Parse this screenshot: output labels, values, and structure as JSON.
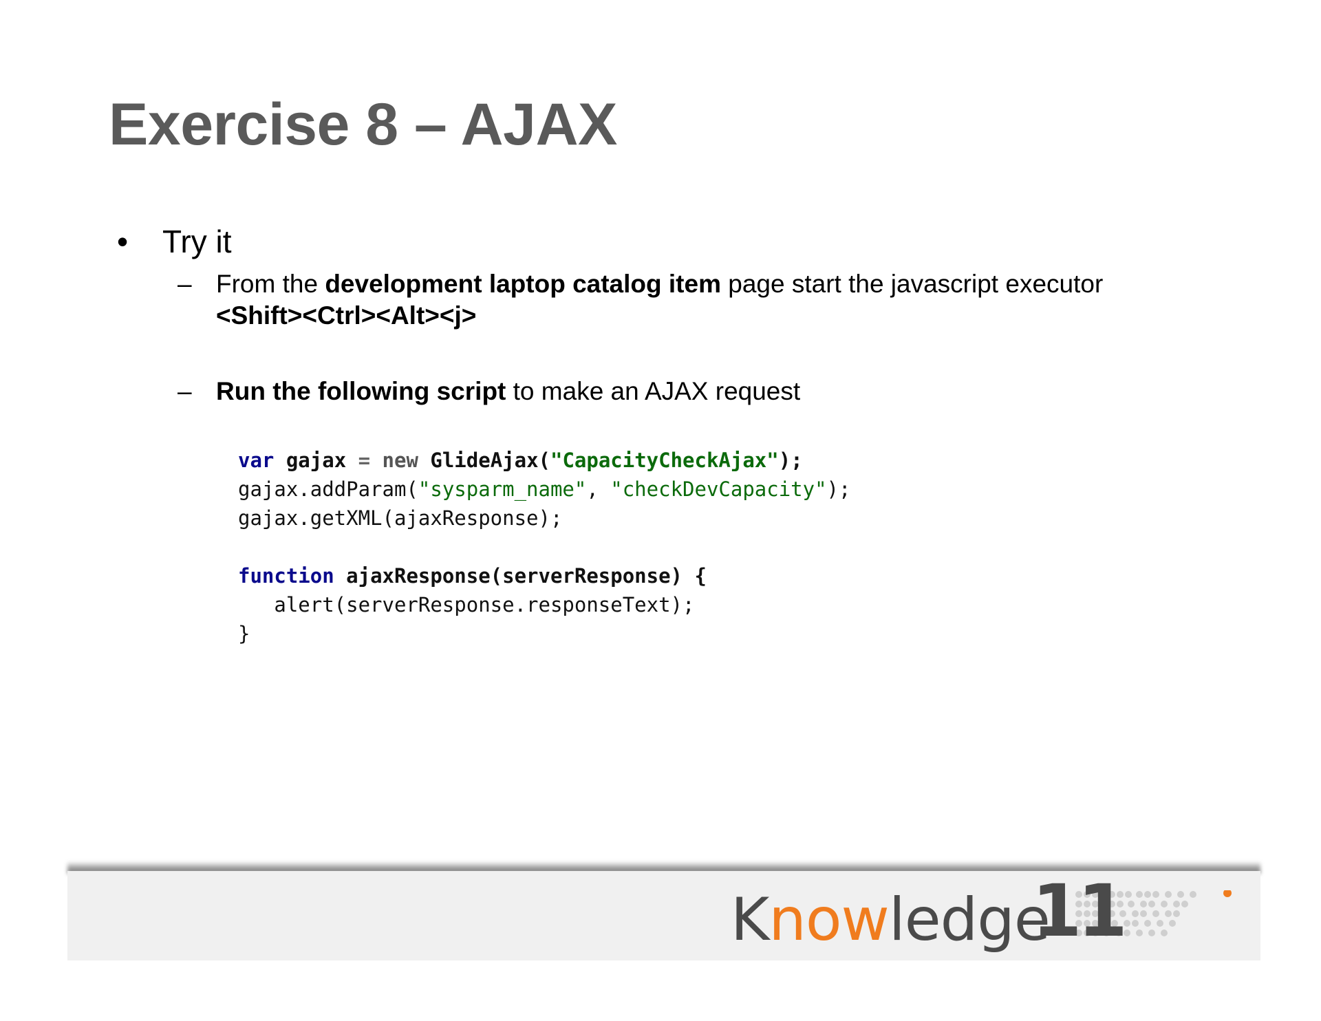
{
  "title": "Exercise 8 – AJAX",
  "bullet": {
    "marker": "•",
    "text": "Try it"
  },
  "sub_items": [
    {
      "marker": "–",
      "line1_pre": "From the ",
      "line1_bold": "development laptop catalog item",
      "line1_post": " page start the javascript executor",
      "line2_bold": "<Shift><Ctrl><Alt><j>"
    },
    {
      "marker": "–",
      "bold": "Run the following script",
      "post": " to make an AJAX request"
    }
  ],
  "code": {
    "l1": {
      "kw": "var",
      "ident": " gajax ",
      "op": "=",
      "new": " new ",
      "call": "GlideAjax(",
      "str": "\"CapacityCheckAjax\"",
      "end": ");"
    },
    "l2": {
      "pre": "gajax.addParam(",
      "s1": "\"sysparm_name\"",
      "mid": ", ",
      "s2": "\"checkDevCapacity\"",
      "end": ");"
    },
    "l3": {
      "text": "gajax.getXML(ajaxResponse);"
    },
    "l5": {
      "kw": "function",
      "rest": " ajaxResponse(serverResponse) {"
    },
    "l6": {
      "text": "   alert(serverResponse.responseText);"
    },
    "l7": {
      "text": "}"
    }
  },
  "logo": {
    "part1": "K",
    "part2": "now",
    "part3": "ledge",
    "number": "11",
    "accent_color": "#f07c1e",
    "text_color": "#4a4a4a"
  }
}
